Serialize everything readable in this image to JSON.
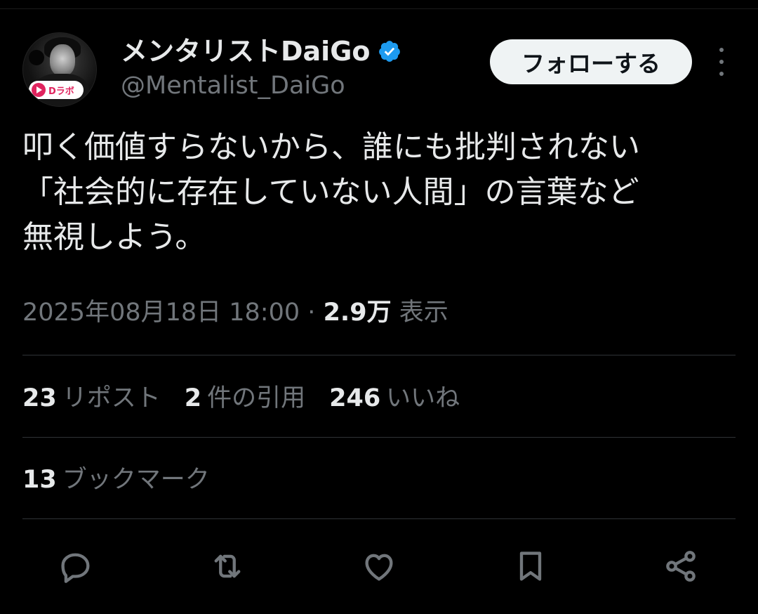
{
  "author": {
    "display_name": "メンタリストDaiGo",
    "handle": "@Mentalist_DaiGo",
    "verified": true,
    "avatar_badge_text": "Dラボ"
  },
  "follow_label": "フォローする",
  "tweet": {
    "lines": [
      "叩く価値すらないから、誰にも批判されない",
      "「社会的に存在していない人間」の言葉など",
      "無視しよう。"
    ]
  },
  "meta": {
    "timestamp": "2025年08月18日 18:00",
    "separator": "·",
    "views_count": "2.9万",
    "views_label": "表示"
  },
  "stats": {
    "reposts": {
      "count": "23",
      "label": "リポスト"
    },
    "quotes": {
      "count": "2",
      "label": "件の引用"
    },
    "likes": {
      "count": "246",
      "label": "いいね"
    },
    "bookmarks": {
      "count": "13",
      "label": "ブックマーク"
    }
  },
  "colors": {
    "background": "#000000",
    "text_primary": "#e7e9ea",
    "text_secondary": "#71767b",
    "divider": "#2f3336",
    "verified_blue": "#1d9bf0",
    "follow_button_bg": "#eff3f4"
  },
  "action_icons": [
    "reply-icon",
    "repost-icon",
    "like-icon",
    "bookmark-icon",
    "share-icon"
  ]
}
